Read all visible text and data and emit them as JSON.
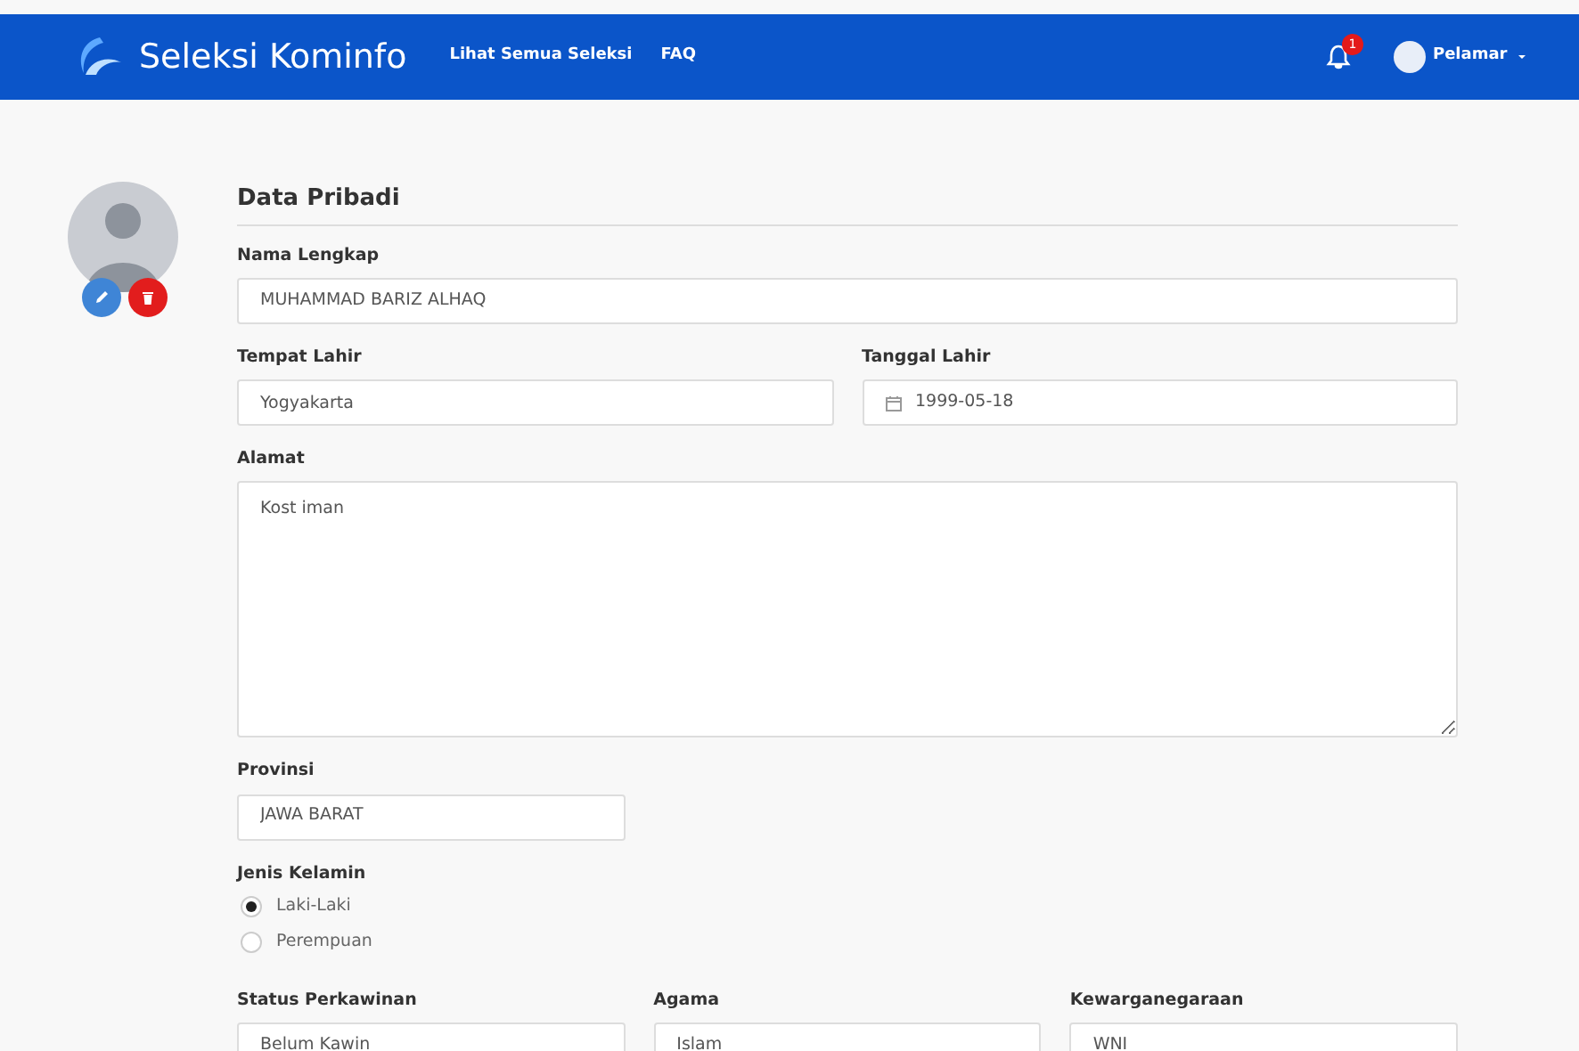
{
  "navbar": {
    "brand": "Seleksi Kominfo",
    "links": [
      "Lihat Semua Seleksi",
      "FAQ"
    ],
    "notification_count": "1",
    "user": "Pelamar"
  },
  "section_title": "Data Pribadi",
  "rows": [
    [
      {
        "kind": "text",
        "label": "Nama Lengkap",
        "value": "MUHAMMAD BARIZ ALHAQ"
      }
    ],
    [
      {
        "kind": "text",
        "label": "Tempat Lahir",
        "value": "Yogyakarta"
      },
      {
        "kind": "date",
        "label": "Tanggal Lahir",
        "value": "1999-05-18"
      }
    ],
    [
      {
        "kind": "textarea",
        "label": "Alamat",
        "value": "Kost iman"
      }
    ],
    [
      {
        "kind": "select",
        "label": "Provinsi",
        "value": "JAWA BARAT"
      }
    ],
    [
      {
        "kind": "radio",
        "label": "Jenis Kelamin",
        "options": [
          {
            "label": "Laki-Laki",
            "selected": true
          },
          {
            "label": "Perempuan",
            "selected": false
          }
        ]
      }
    ],
    [
      {
        "kind": "select",
        "label": "Status Perkawinan",
        "value": "Belum Kawin"
      },
      {
        "kind": "select",
        "label": "Agama",
        "value": "Islam"
      },
      {
        "kind": "select",
        "label": "Kewarganegaraan",
        "value": "WNI"
      }
    ]
  ]
}
